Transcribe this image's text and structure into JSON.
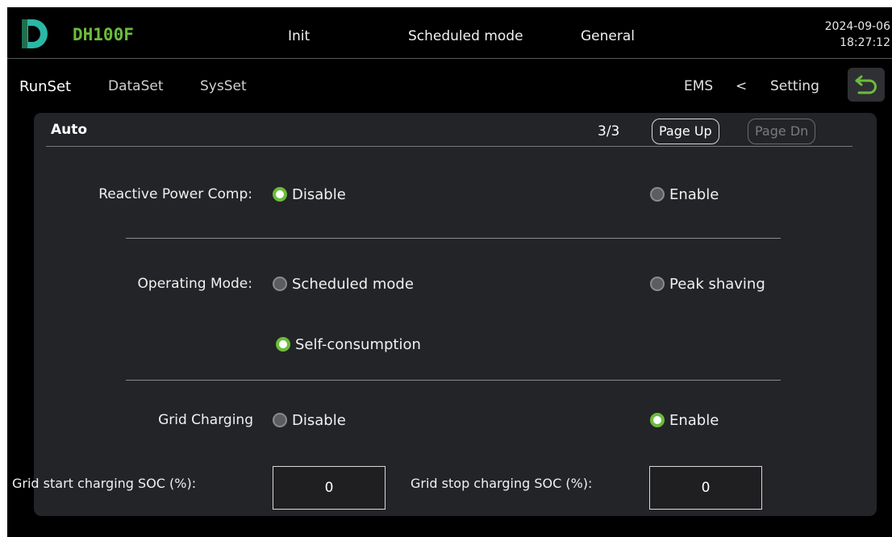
{
  "header": {
    "model": "DH100F",
    "items": [
      "Init",
      "Scheduled mode",
      "General"
    ],
    "date": "2024-09-06",
    "time": "18:27:12",
    "colors": {
      "logo_dark": "#1f6f4f",
      "logo_light": "#2bb7a6",
      "brand_green": "#6cbc3b"
    }
  },
  "nav": {
    "tabs": [
      "RunSet",
      "DataSet",
      "SysSet"
    ],
    "breadcrumb": {
      "current": "EMS",
      "separator": "<",
      "parent": "Setting"
    },
    "back_icon": "undo-arrow-icon"
  },
  "panel": {
    "title": "Auto",
    "page": "3/3",
    "page_up": "Page Up",
    "page_down": "Page Dn"
  },
  "reactive_power": {
    "label": "Reactive Power Comp:",
    "options": [
      {
        "label": "Disable",
        "selected": true
      },
      {
        "label": "Enable",
        "selected": false
      }
    ]
  },
  "operating_mode": {
    "label": "Operating Mode:",
    "options": [
      {
        "label": "Scheduled mode",
        "selected": false
      },
      {
        "label": "Peak shaving",
        "selected": false
      },
      {
        "label": "Self-consumption",
        "selected": true
      }
    ]
  },
  "grid_charging": {
    "label": "Grid Charging",
    "options": [
      {
        "label": "Disable",
        "selected": false
      },
      {
        "label": "Enable",
        "selected": true
      }
    ]
  },
  "soc": {
    "start_label": "Grid start charging SOC (%):",
    "start_value": "0",
    "stop_label": "Grid stop charging SOC (%):",
    "stop_value": "0"
  }
}
